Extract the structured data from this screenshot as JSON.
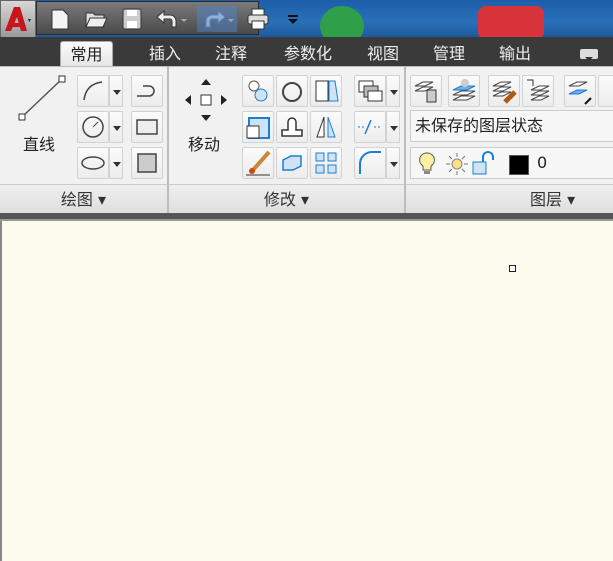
{
  "quick_access": {
    "icons": [
      "autocad-logo-icon",
      "new-icon",
      "open-icon",
      "save-icon",
      "undo-icon",
      "redo-icon",
      "print-icon",
      "customize-dropdown-icon"
    ]
  },
  "tabs": [
    {
      "label": "常用",
      "active": true
    },
    {
      "label": "插入"
    },
    {
      "label": "注释"
    },
    {
      "label": "参数化"
    },
    {
      "label": "视图"
    },
    {
      "label": "管理"
    },
    {
      "label": "输出"
    }
  ],
  "ribbon": {
    "draw": {
      "title": "绘图",
      "line_label": "直线"
    },
    "modify": {
      "title": "修改",
      "move_label": "移动"
    },
    "layers": {
      "title": "图层",
      "layer_state": "未保存的图层状态",
      "current_layer": "0",
      "layer_color": "#000000"
    }
  },
  "colors": {
    "accent": "#1a7fd4",
    "canvas": "#fdfaee"
  }
}
